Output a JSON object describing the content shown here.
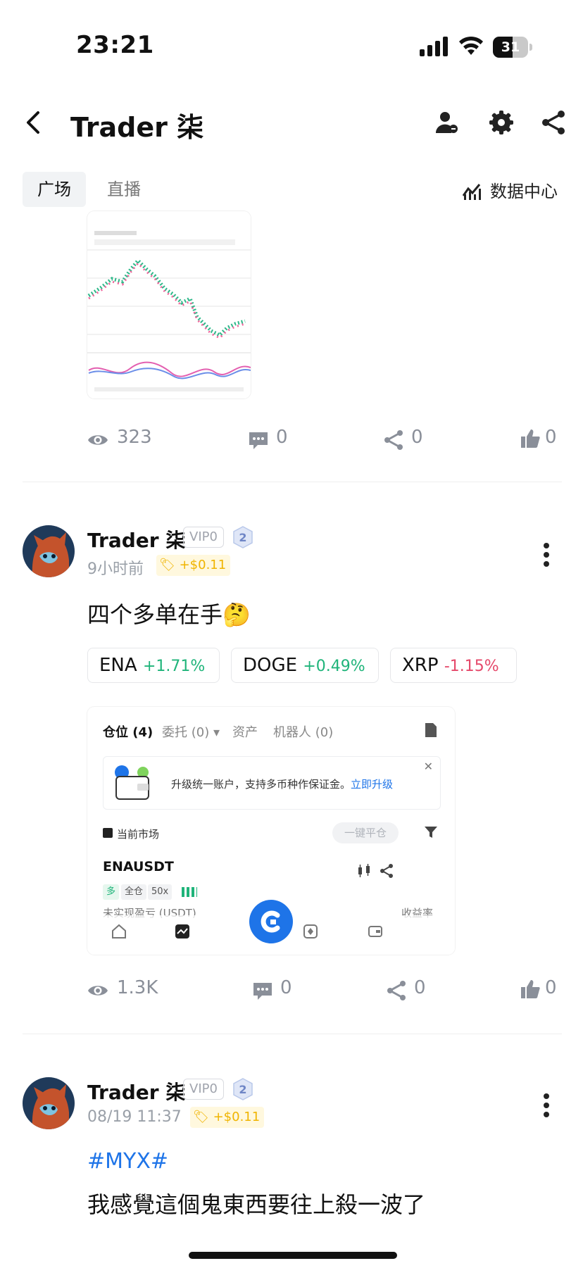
{
  "status": {
    "time": "23:21",
    "battery": "31"
  },
  "header": {
    "title": "Trader 柒"
  },
  "tabs": [
    {
      "label": "广场"
    },
    {
      "label": "直播"
    }
  ],
  "data_center": "数据中心",
  "post1": {
    "views": "323",
    "comments": "0",
    "shares": "0",
    "likes": "0"
  },
  "post2": {
    "author": "Trader 柒",
    "vip": "VIP0",
    "level": "2",
    "time": "9小时前",
    "tip": "+$0.11",
    "text": "四个多单在手🤔",
    "tickers": [
      {
        "symbol": "ENA",
        "change": "+1.71%"
      },
      {
        "symbol": "DOGE",
        "change": "+0.49%"
      },
      {
        "symbol": "XRP",
        "change": "-1.15%"
      }
    ],
    "screenshot": {
      "tabs": [
        "仓位 (4)",
        "委托 (0) ▾",
        "资产",
        "机器人 (0)"
      ],
      "banner": "升级统一账户，支持多币种作保证金。",
      "banner_link": "立即升级",
      "current_market": "当前市场",
      "close_all": "一键平仓",
      "symbol": "ENAUSDT",
      "tag_long": "多",
      "tag_margin": "全仓",
      "tag_leverage": "50x",
      "unrealized": "未实现盈亏 (USDT)",
      "roi": "收益率"
    },
    "views": "1.3K",
    "comments": "0",
    "shares": "0",
    "likes": "0"
  },
  "post3": {
    "author": "Trader 柒",
    "vip": "VIP0",
    "level": "2",
    "time": "08/19 11:37",
    "tip": "+$0.11",
    "hashtag": "#MYX#",
    "text": "我感覺這個鬼東西要往上殺一波了"
  },
  "colors": {
    "accent": "#1e74e8",
    "positive": "#1fb47a",
    "negative": "#e5486a",
    "tip": "#f0b400"
  }
}
